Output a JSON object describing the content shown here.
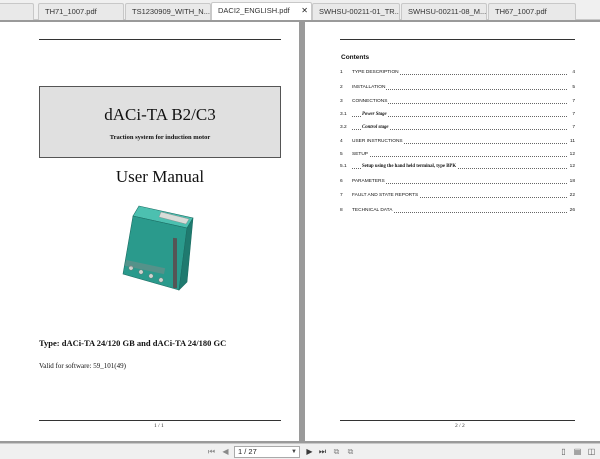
{
  "tabs": [
    {
      "label": "df",
      "active": false
    },
    {
      "label": "TH71_1007.pdf",
      "active": false
    },
    {
      "label": "TS1230909_WITH_N...",
      "active": false
    },
    {
      "label": "DACI2_ENGLISH.pdf",
      "active": true
    },
    {
      "label": "SWHSU-00211-01_TR...",
      "active": false
    },
    {
      "label": "SWHSU-00211-08_M...",
      "active": false
    },
    {
      "label": "TH67_1007.pdf",
      "active": false
    }
  ],
  "page1": {
    "title": "dACi-TA B2/C3",
    "subtitle": "Traction system for induction motor",
    "manual": "User Manual",
    "type_line": "Type: dACi-TA 24/120 GB  and dACi-TA 24/180 GC",
    "valid_line": "Valid for software:  59_101(49)",
    "page_number": "1 / 1"
  },
  "page2": {
    "toc_title": "Contents",
    "toc": [
      {
        "num": "1",
        "label": "TYPE DESCRIPTION",
        "page": "4",
        "level": 1
      },
      {
        "num": "2",
        "label": "INSTALLATION",
        "page": "5",
        "level": 1
      },
      {
        "num": "3",
        "label": "CONNECTIONS",
        "page": "7",
        "level": 1
      },
      {
        "num": "3.1",
        "label": "Power Stage",
        "page": "7",
        "level": 2
      },
      {
        "num": "3.2",
        "label": "Control stage",
        "page": "7",
        "level": 2
      },
      {
        "num": "4",
        "label": "USER INSTRUCTIONS",
        "page": "11",
        "level": 1
      },
      {
        "num": "5",
        "label": "SETUP",
        "page": "12",
        "level": 1
      },
      {
        "num": "5.1",
        "label": "Setup using the hand held terminal, type BPK",
        "page": "12",
        "level": 3
      },
      {
        "num": "6",
        "label": "PARAMETERS",
        "page": "18",
        "level": 1
      },
      {
        "num": "7",
        "label": "FAULT AND STATE REPORTS",
        "page": "22",
        "level": 1
      },
      {
        "num": "8",
        "label": "TECHNICAL DATA",
        "page": "26",
        "level": 1
      }
    ],
    "page_number": "2 / 2"
  },
  "toolbar": {
    "page_value": "1 / 27",
    "dropdown_icon": "chevron-down-icon"
  },
  "colors": {
    "product_body": "#2a9a8c",
    "viewer_bg": "#9a9a9a"
  }
}
